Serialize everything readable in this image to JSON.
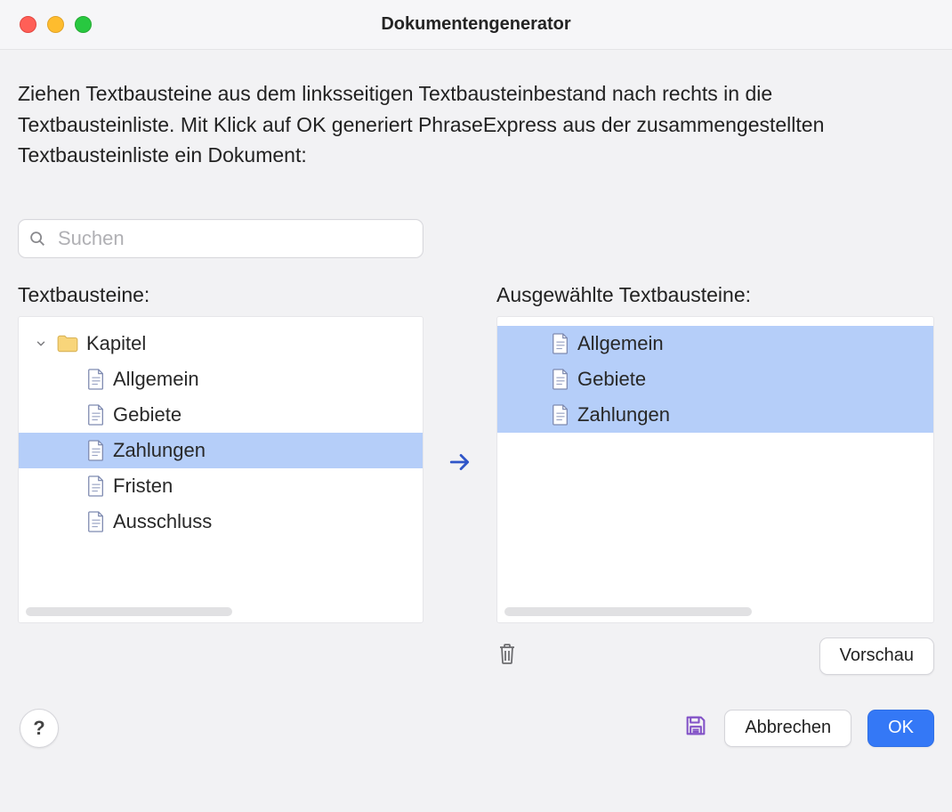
{
  "window": {
    "title": "Dokumentengenerator"
  },
  "intro_text": "Ziehen Textbausteine aus dem linksseitigen Textbausteinbestand nach rechts in die Textbausteinliste. Mit Klick auf OK generiert PhraseExpress aus der zusammengestellten Textbausteinliste ein Dokument:",
  "search": {
    "placeholder": "Suchen",
    "value": ""
  },
  "left_panel": {
    "label": "Textbausteine:",
    "root": {
      "label": "Kapitel",
      "expanded": true
    },
    "items": [
      {
        "label": "Allgemein",
        "selected": false
      },
      {
        "label": "Gebiete",
        "selected": false
      },
      {
        "label": "Zahlungen",
        "selected": true
      },
      {
        "label": "Fristen",
        "selected": false
      },
      {
        "label": "Ausschluss",
        "selected": false
      }
    ]
  },
  "right_panel": {
    "label": "Ausgewählte Textbausteine:",
    "items": [
      {
        "label": "Allgemein",
        "selected": true
      },
      {
        "label": "Gebiete",
        "selected": true
      },
      {
        "label": "Zahlungen",
        "selected": true
      }
    ]
  },
  "buttons": {
    "preview": "Vorschau",
    "cancel": "Abbrechen",
    "ok": "OK"
  }
}
